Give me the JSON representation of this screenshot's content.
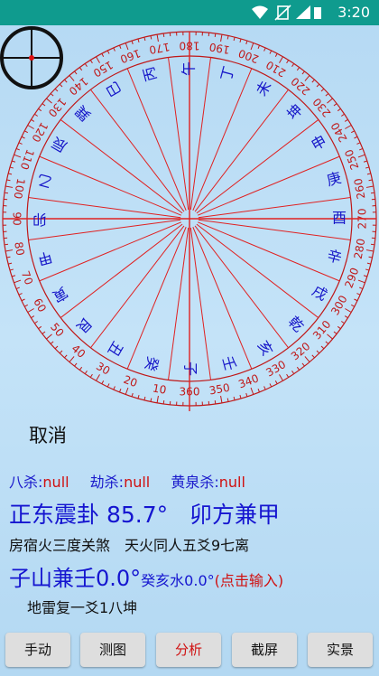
{
  "status": {
    "time": "3:20"
  },
  "compass": {
    "degree_labels": [
      "10",
      "20",
      "30",
      "40",
      "50",
      "60",
      "70",
      "80",
      "90",
      "100",
      "110",
      "120",
      "130",
      "140",
      "150",
      "160",
      "170",
      "180",
      "190",
      "200",
      "210",
      "220",
      "230",
      "240",
      "250",
      "260",
      "270",
      "280",
      "290",
      "300",
      "310",
      "320",
      "330",
      "340",
      "350",
      "360"
    ],
    "mountains": [
      "子",
      "癸",
      "丑",
      "艮",
      "寅",
      "甲",
      "卯",
      "乙",
      "辰",
      "巽",
      "巳",
      "丙",
      "午",
      "丁",
      "未",
      "坤",
      "申",
      "庚",
      "酉",
      "辛",
      "戌",
      "乾",
      "亥",
      "壬"
    ],
    "colors": {
      "line": "#e02020",
      "text": "#1515c8",
      "ticks": "#c01818"
    }
  },
  "actions": {
    "cancel": "取消"
  },
  "info": {
    "bazha_label": "八杀:",
    "bazha_value": "null",
    "jiesha_label": "劫杀:",
    "jiesha_value": "null",
    "huangquan_label": "黄泉杀:",
    "huangquan_value": "null",
    "direction_main": "正东震卦 85.7°",
    "direction_sub": "卯方兼甲",
    "line3": "房宿火三度关煞　天火同人五爻9七离",
    "mountain_main": "子山兼壬0.0°",
    "mountain_small": "癸亥水0.0°",
    "input_hint": "(点击输入)",
    "line5": "地雷复一爻1八坤"
  },
  "buttons": {
    "manual": "手动",
    "measure": "测图",
    "analyze": "分析",
    "screenshot": "截屏",
    "live": "实景"
  }
}
